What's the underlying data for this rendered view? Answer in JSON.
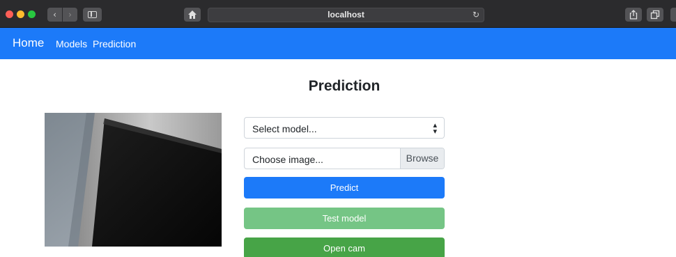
{
  "browser": {
    "url": "localhost",
    "back_icon": "chevron-left-icon",
    "forward_icon": "chevron-right-icon",
    "home_icon": "home-icon",
    "reload_icon": "reload-icon",
    "share_icon": "share-icon",
    "tabs_icon": "tabs-icon"
  },
  "navbar": {
    "brand": "Home",
    "links": [
      {
        "label": "Models"
      },
      {
        "label": "Prediction"
      }
    ],
    "color": "#1c7af9"
  },
  "page": {
    "title": "Prediction"
  },
  "form": {
    "model_select": {
      "value": "Select model..."
    },
    "image_input": {
      "placeholder": "Choose image...",
      "browse_label": "Browse"
    },
    "predict_label": "Predict",
    "test_model_label": "Test model",
    "open_cam_label": "Open cam"
  },
  "colors": {
    "primary": "#1c7af9",
    "success_disabled": "#75c585",
    "success": "#47a447"
  }
}
